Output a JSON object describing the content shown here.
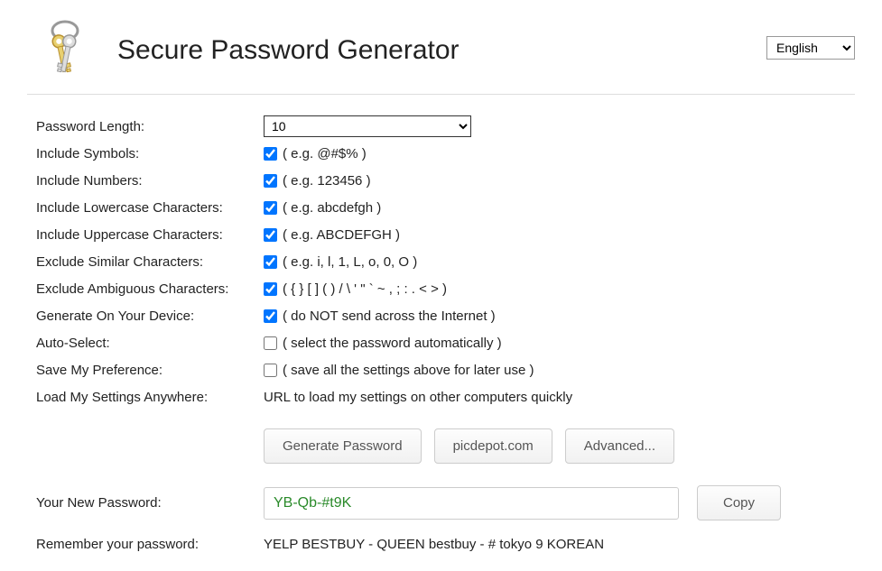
{
  "header": {
    "title": "Secure Password Generator",
    "language_selected": "English"
  },
  "form": {
    "length": {
      "label": "Password Length:",
      "value": "10"
    },
    "symbols": {
      "label": "Include Symbols:",
      "checked": true,
      "hint": "( e.g. @#$% )"
    },
    "numbers": {
      "label": "Include Numbers:",
      "checked": true,
      "hint": "( e.g. 123456 )"
    },
    "lowercase": {
      "label": "Include Lowercase Characters:",
      "checked": true,
      "hint": "( e.g. abcdefgh )"
    },
    "uppercase": {
      "label": "Include Uppercase Characters:",
      "checked": true,
      "hint": "( e.g. ABCDEFGH )"
    },
    "similar": {
      "label": "Exclude Similar Characters:",
      "checked": true,
      "hint": "( e.g. i, l, 1, L, o, 0, O )"
    },
    "ambiguous": {
      "label": "Exclude Ambiguous Characters:",
      "checked": true,
      "hint": "( { } [ ] ( ) / \\ ' \" ` ~ , ; : . < > )"
    },
    "local": {
      "label": "Generate On Your Device:",
      "checked": true,
      "hint": "( do NOT send across the Internet )"
    },
    "autoselect": {
      "label": "Auto-Select:",
      "checked": false,
      "hint": "( select the password automatically )"
    },
    "savepref": {
      "label": "Save My Preference:",
      "checked": false,
      "hint": "( save all the settings above for later use )"
    },
    "loadsettings": {
      "label": "Load My Settings Anywhere:",
      "hint": "URL to load my settings on other computers quickly"
    }
  },
  "buttons": {
    "generate": "Generate Password",
    "picdepot": "picdepot.com",
    "advanced": "Advanced..."
  },
  "output": {
    "label": "Your New Password:",
    "value": "YB-Qb-#t9K",
    "copy": "Copy"
  },
  "remember": {
    "label": "Remember your password:",
    "text": "YELP BESTBUY - QUEEN bestbuy - # tokyo 9 KOREAN"
  }
}
